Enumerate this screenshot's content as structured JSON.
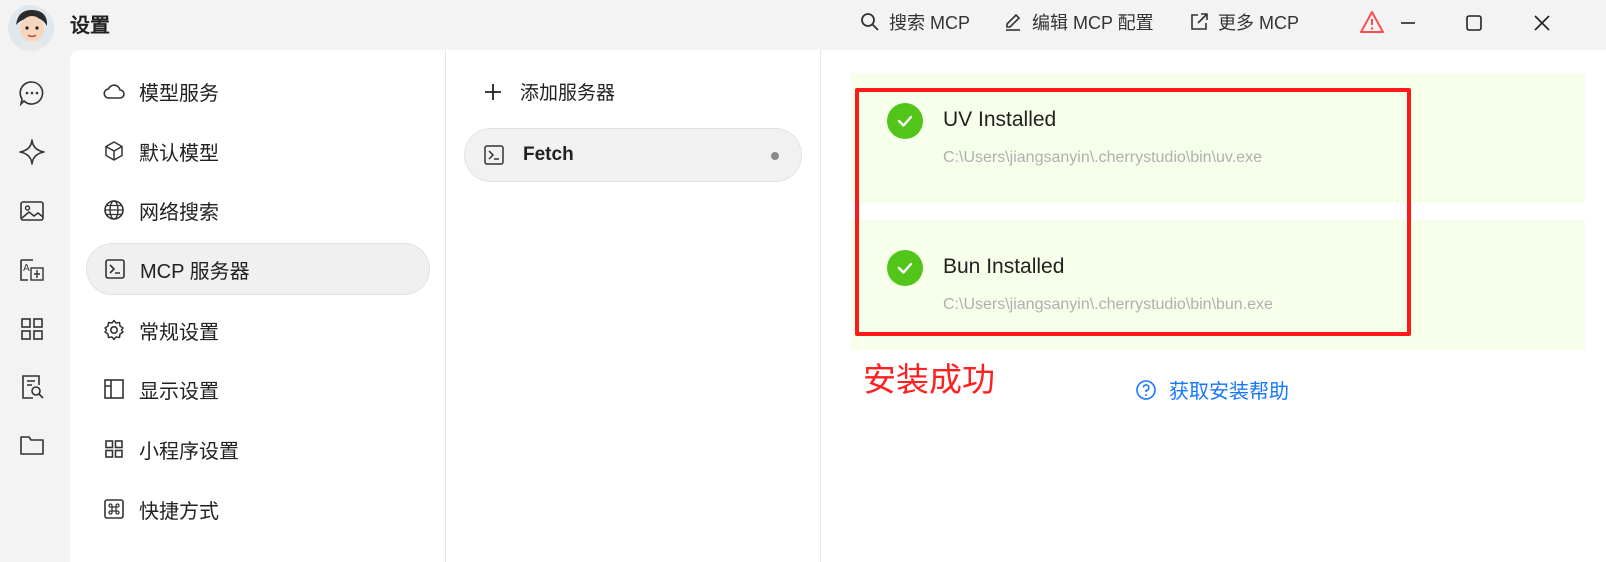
{
  "app": {
    "title": "设置"
  },
  "titlebar": {
    "search_label": "搜索 MCP",
    "edit_label": "编辑 MCP 配置",
    "more_label": "更多 MCP"
  },
  "rail": {
    "icons": [
      "chat-icon",
      "sparkle-icon",
      "image-icon",
      "translate-icon",
      "apps-icon",
      "knowledge-icon",
      "folder-icon"
    ]
  },
  "settings_menu": {
    "items": [
      {
        "label": "模型服务",
        "icon": "cloud-icon"
      },
      {
        "label": "默认模型",
        "icon": "cube-icon"
      },
      {
        "label": "网络搜索",
        "icon": "globe-icon"
      },
      {
        "label": "MCP 服务器",
        "icon": "terminal-icon",
        "active": true
      },
      {
        "label": "常规设置",
        "icon": "gear-icon"
      },
      {
        "label": "显示设置",
        "icon": "layout-icon"
      },
      {
        "label": "小程序设置",
        "icon": "grid-icon"
      },
      {
        "label": "快捷方式",
        "icon": "command-icon"
      }
    ]
  },
  "servers": {
    "add_label": "添加服务器",
    "items": [
      {
        "name": "Fetch"
      }
    ]
  },
  "install_status": {
    "uv": {
      "title": "UV Installed",
      "path": "C:\\Users\\jiangsanyin\\.cherrystudio\\bin\\uv.exe"
    },
    "bun": {
      "title": "Bun Installed",
      "path": "C:\\Users\\jiangsanyin\\.cherrystudio\\bin\\bun.exe"
    }
  },
  "annotation": {
    "text": "安装成功"
  },
  "help": {
    "label": "获取安装帮助"
  },
  "colors": {
    "accent": "#1677ff",
    "success": "#52c41a",
    "success_bg": "#f5ffea",
    "annotation": "#ff1a1a"
  }
}
